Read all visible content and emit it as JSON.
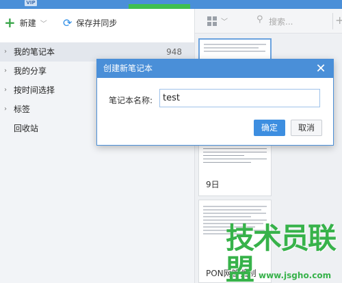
{
  "app": {
    "vip_badge": "VIP"
  },
  "toolbar": {
    "new_label": "新建",
    "sync_label": "保存并同步"
  },
  "sidebar": {
    "items": [
      {
        "label": "我的笔记本",
        "count": "948",
        "expandable": true,
        "selected": true
      },
      {
        "label": "我的分享",
        "expandable": true
      },
      {
        "label": "按时间选择",
        "expandable": true
      },
      {
        "label": "标签",
        "expandable": true
      },
      {
        "label": "回收站",
        "expandable": false
      }
    ]
  },
  "notes_toolbar": {
    "search_placeholder": "搜索..."
  },
  "notes": [
    {
      "title": ""
    },
    {
      "title": "9日"
    },
    {
      "title": "PON网管强制"
    }
  ],
  "dialog": {
    "title": "创建新笔记本",
    "field_label": "笔记本名称:",
    "field_value": "test",
    "ok_label": "确定",
    "cancel_label": "取消"
  },
  "watermark": {
    "text": "技术员联盟",
    "url": "www.jsgho.com"
  },
  "colors": {
    "accent": "#4a8fd8",
    "primary_button": "#3d8ee0",
    "watermark": "#37b24a",
    "add_icon": "#3aa64a"
  }
}
